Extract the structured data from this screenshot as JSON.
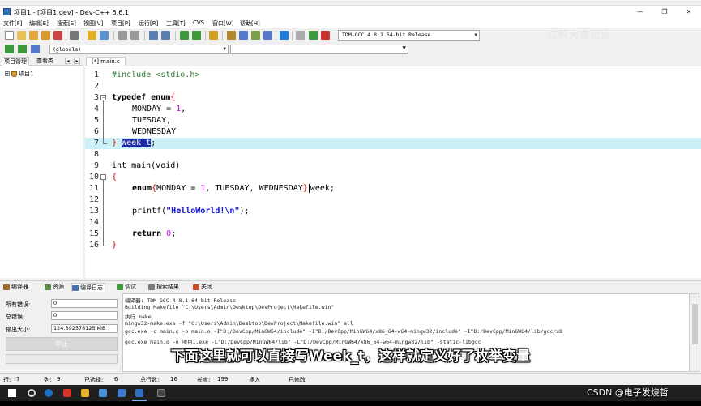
{
  "window": {
    "title": "项目1 - [项目1.dev] - Dev-C++ 5.6.1",
    "controls": {
      "minimize": "—",
      "maximize": "❐",
      "close": "✕"
    }
  },
  "menu": [
    "文件[F]",
    "编辑[E]",
    "搜索[S]",
    "视图[V]",
    "项目[P]",
    "运行[R]",
    "工具[T]",
    "CVS",
    "窗口[W]",
    "帮助[H]"
  ],
  "toolbar": {
    "compiler": "TDM-GCC 4.8.1 64-bit Release",
    "scope": "(globals)",
    "symbol": ""
  },
  "left_panel": {
    "tabs": [
      "项目管理",
      "查看类"
    ],
    "nav_prev": "◂",
    "nav_next": "▸",
    "tree_expander": "+",
    "project": "项目1"
  },
  "editor": {
    "tab": "[*] main.c",
    "line_numbers": [
      "1",
      "2",
      "3",
      "4",
      "5",
      "6",
      "7",
      "8",
      "9",
      "10",
      "11",
      "12",
      "13",
      "14",
      "15",
      "16"
    ],
    "code": {
      "l1": "#include <stdio.h>",
      "l3_kw": "typedef enum",
      "l3_brace": "{",
      "l4_name": "MONDAY = ",
      "l4_num": "1",
      "l4_comma": ",",
      "l5": "TUESDAY,",
      "l6": "WEDNESDAY",
      "l7_brace": "}",
      "l7_sel": "Week_t",
      "l7_semi": ";",
      "l9": "int main(void)",
      "l10_brace": "{",
      "l11_kw": "enum",
      "l11_brace_open": "{",
      "l11_body": "MONDAY = ",
      "l11_num": "1",
      "l11_rest": ", TUESDAY, WEDNESDAY",
      "l11_brace_close": "}",
      "l11_var": "week;",
      "l13_fn": "printf(",
      "l13_str": "\"HelloWorld!\\n\"",
      "l13_end": ");",
      "l15_kw": "return ",
      "l15_num": "0",
      "l15_semi": ";",
      "l16_brace": "}"
    },
    "fold_minus": "−"
  },
  "bottom_tabs": [
    "编译器",
    "资源",
    "编译日志",
    "调试",
    "搜索结果",
    "关闭"
  ],
  "stats": {
    "errors_label": "所有错误:",
    "errors_value": "0",
    "warnings_label": "总错误:",
    "warnings_value": "0",
    "output_label": "输出大小:",
    "output_value": "124.392578125 KiB",
    "stop_button": "中止"
  },
  "log": [
    "编译器: TDM-GCC 4.8.1 64-bit Release",
    "Building Makefile \"C:\\Users\\Admin\\Desktop\\DevProject\\Makefile.win\"",
    "执行 make...",
    "mingw32-make.exe -f \"C:\\Users\\Admin\\Desktop\\DevProject\\Makefile.win\" all",
    "gcc.exe -c main.c -o main.o -I\"D:/DevCpp/MinGW64/include\" -I\"D:/DevCpp/MinGW64/x86_64-w64-mingw32/include\" -I\"D:/DevCpp/MinGW64/lib/gcc/x8",
    "gcc.exe main.o -o 项目1.exe -L\"D:/DevCpp/MinGW64/lib\" -L\"D:/DevCpp/MinGW64/x86_64-w64-mingw32/lib\" -static-libgcc"
  ],
  "statusbar": {
    "row_label": "行:",
    "row_value": "7",
    "col_label": "列:",
    "col_value": "9",
    "sel_label": "已选择:",
    "sel_value": "6",
    "lines_label": "总行数:",
    "lines_value": "16",
    "len_label": "长度:",
    "len_value": "199",
    "mode": "插入",
    "modified": "已修改"
  },
  "overlays": {
    "watermark": "江科大自化协",
    "subtitle": "下面这里就可以直接写Week_t，这样就定义好了枚举变量",
    "csdn": "CSDN @电子发烧哲"
  },
  "colors": {
    "current_line": "#ccf0f7",
    "selection": "#1b2ba6",
    "preprocessor": "#2e7d32",
    "number": "#d000ff",
    "string": "#1010e0",
    "brace": "#d00000"
  }
}
